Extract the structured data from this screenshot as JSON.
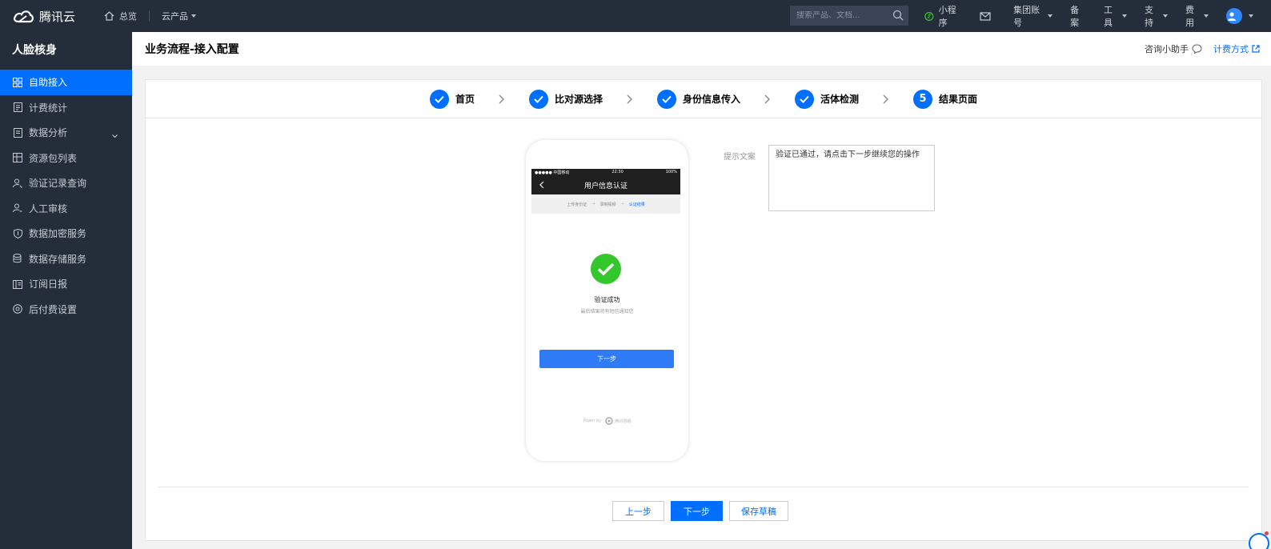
{
  "topbar": {
    "brand": "腾讯云",
    "overview": "总览",
    "products": "云产品",
    "search_placeholder": "搜索产品、文档...",
    "mini_program": "小程序",
    "group_account": "集团账号",
    "icp": "备案",
    "tools": "工具",
    "support": "支持",
    "costs": "费用"
  },
  "sidebar": {
    "title": "人脸核身",
    "items": [
      {
        "label": "自助接入",
        "icon": "grid-icon"
      },
      {
        "label": "计费统计",
        "icon": "document-icon"
      },
      {
        "label": "数据分析",
        "icon": "chart-doc-icon"
      },
      {
        "label": "资源包列表",
        "icon": "package-icon"
      },
      {
        "label": "验证记录查询",
        "icon": "user-search-icon"
      },
      {
        "label": "人工审核",
        "icon": "user-check-icon"
      },
      {
        "label": "数据加密服务",
        "icon": "shield-icon"
      },
      {
        "label": "数据存储服务",
        "icon": "database-icon"
      },
      {
        "label": "订阅日报",
        "icon": "report-icon"
      },
      {
        "label": "后付费设置",
        "icon": "settings-circle-icon"
      }
    ]
  },
  "header": {
    "title": "业务流程-接入配置",
    "assistant": "咨询小助手",
    "billing_method": "计费方式"
  },
  "steps": [
    {
      "label": "首页",
      "done": true
    },
    {
      "label": "比对源选择",
      "done": true
    },
    {
      "label": "身份信息传入",
      "done": true
    },
    {
      "label": "活体检测",
      "done": true
    },
    {
      "label": "结果页面",
      "done": false,
      "number": "5"
    }
  ],
  "phone": {
    "status_left": "●●●●● 中国移动",
    "status_time": "22:30",
    "status_right": "100%",
    "nav_title": "用户信息认证",
    "progress": [
      "上传身份证",
      "录制视频",
      "认证结果"
    ],
    "result_title": "验证成功",
    "result_sub": "最后结果将有短信通知您",
    "next_button": "下一步",
    "footer_powered": "Power by",
    "footer_brand": "腾讯慧眼"
  },
  "tip": {
    "label": "提示文案",
    "value": "验证已通过，请点击下一步继续您的操作"
  },
  "actions": {
    "prev": "上一步",
    "next": "下一步",
    "draft": "保存草稿"
  },
  "colors": {
    "primary": "#006eff",
    "topbar_bg": "#242e3b",
    "success": "#34c72c"
  }
}
